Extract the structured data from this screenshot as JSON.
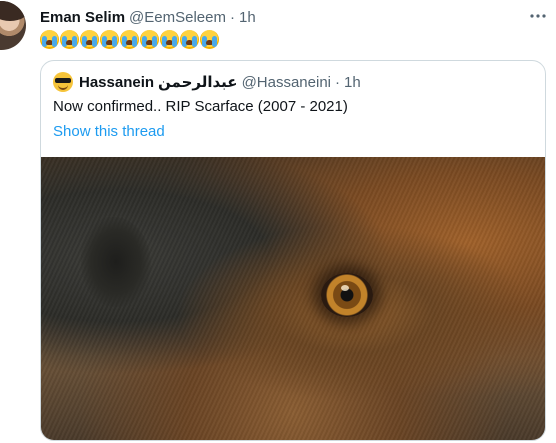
{
  "tweet": {
    "author_name": "Eman Selim",
    "author_handle": "@EemSeleem",
    "separator": "·",
    "time": "1h",
    "emoji_count": 9,
    "more_icon": "more-horizontal-icon"
  },
  "quoted_tweet": {
    "author_name": "Hassanein",
    "author_arabic_name": "عبدالرحمن",
    "author_handle": "@Hassaneini",
    "separator": "·",
    "time": "1h",
    "text": "Now confirmed.. RIP Scarface (2007 - 2021)",
    "show_thread_label": "Show this thread"
  },
  "colors": {
    "link": "#1d9bf0",
    "secondary_text": "#536471",
    "primary_text": "#0f1419",
    "border": "#cfd9de"
  }
}
